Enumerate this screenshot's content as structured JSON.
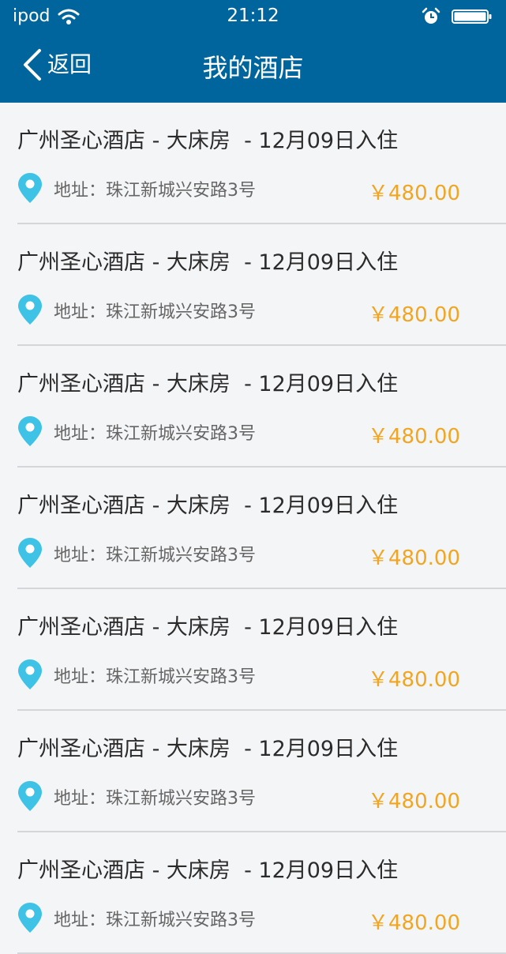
{
  "status_bar": {
    "carrier": "ipod",
    "time": "21:12"
  },
  "nav": {
    "back_label": "返回",
    "title": "我的酒店"
  },
  "hotels": [
    {
      "title": "广州圣心酒店 - 大床房  - 12月09日入住",
      "address": "地址：珠江新城兴安路3号",
      "price": "￥480.00"
    },
    {
      "title": "广州圣心酒店 - 大床房  - 12月09日入住",
      "address": "地址：珠江新城兴安路3号",
      "price": "￥480.00"
    },
    {
      "title": "广州圣心酒店 - 大床房  - 12月09日入住",
      "address": "地址：珠江新城兴安路3号",
      "price": "￥480.00"
    },
    {
      "title": "广州圣心酒店 - 大床房  - 12月09日入住",
      "address": "地址：珠江新城兴安路3号",
      "price": "￥480.00"
    },
    {
      "title": "广州圣心酒店 - 大床房  - 12月09日入住",
      "address": "地址：珠江新城兴安路3号",
      "price": "￥480.00"
    },
    {
      "title": "广州圣心酒店 - 大床房  - 12月09日入住",
      "address": "地址：珠江新城兴安路3号",
      "price": "￥480.00"
    },
    {
      "title": "广州圣心酒店 - 大床房  - 12月09日入住",
      "address": "地址：珠江新城兴安路3号",
      "price": "￥480.00"
    }
  ],
  "icons": {
    "status": [
      "wifi-icon",
      "alarm-icon",
      "battery-icon"
    ],
    "back": "chevron-left-icon",
    "location": "location-pin-icon"
  },
  "colors": {
    "header_background": "#00659c",
    "page_background": "#f4f5f7",
    "price": "#f0a623",
    "pin": "#3ec3e6",
    "divider": "#d4d6d9"
  }
}
